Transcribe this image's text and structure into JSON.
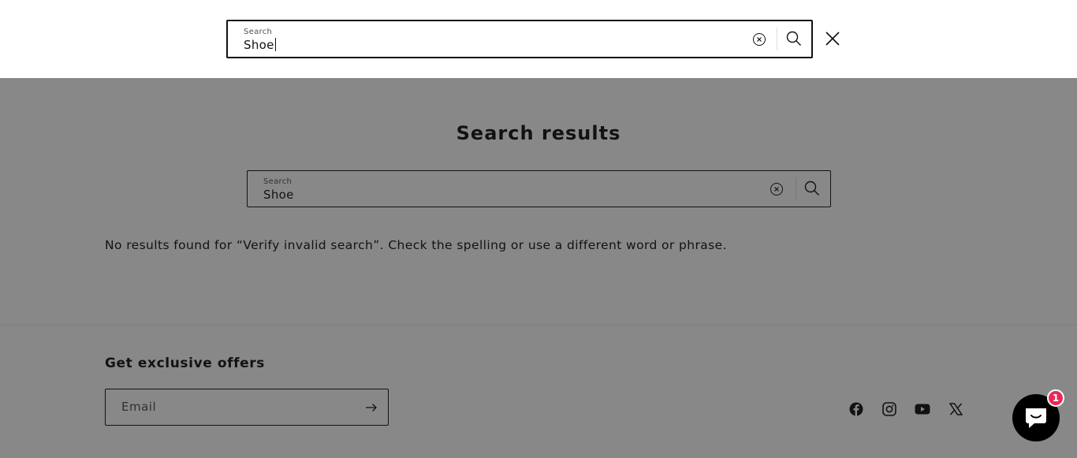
{
  "modal_search": {
    "label": "Search",
    "value": "Shoe"
  },
  "main": {
    "title": "Search results",
    "search": {
      "label": "Search",
      "value": "Shoe"
    },
    "no_results_message": "No results found for “Verify invalid search”. Check the spelling or use a different word or phrase."
  },
  "footer": {
    "offers_title": "Get exclusive offers",
    "email_placeholder": "Email",
    "social_icons": [
      "facebook-icon",
      "instagram-icon",
      "youtube-icon",
      "x-icon"
    ]
  },
  "chat": {
    "unread_count": "1",
    "badge_color": "#e82a5b"
  },
  "colors": {
    "text": "#121212",
    "overlay": "rgba(18,18,18,0.5)"
  }
}
